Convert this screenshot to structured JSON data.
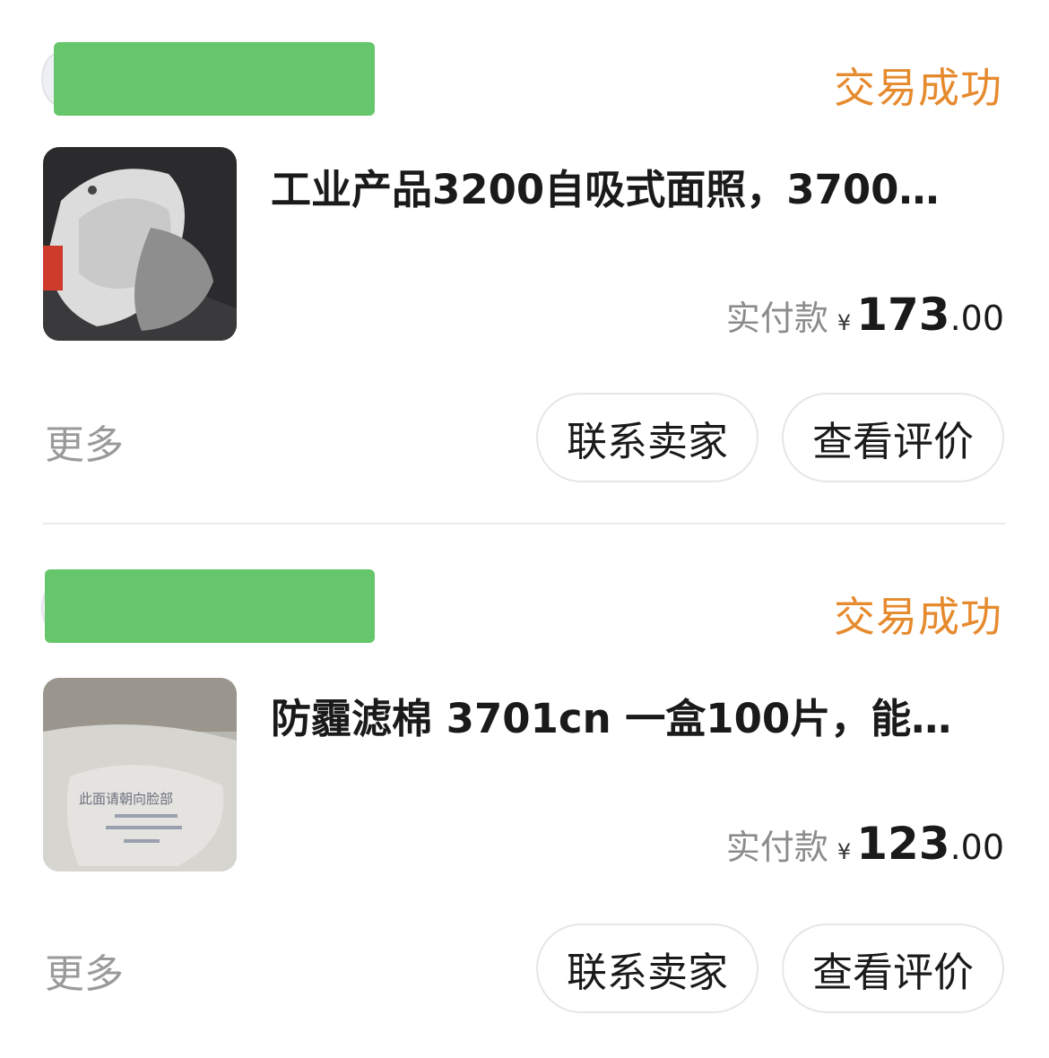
{
  "orders": [
    {
      "status": "交易成功",
      "title": "工业产品3200自吸式面照，3700…",
      "price_label": "实付款",
      "currency": "¥",
      "price_int": "173",
      "price_dec": ".00",
      "more": "更多",
      "contact_button": "联系卖家",
      "review_button": "查看评价"
    },
    {
      "status": "交易成功",
      "title": "防霾滤棉 3701cn 一盒100片，能…",
      "price_label": "实付款",
      "currency": "¥",
      "price_int": "123",
      "price_dec": ".00",
      "more": "更多",
      "contact_button": "联系卖家",
      "review_button": "查看评价",
      "thumb_text": "此面请朝向脸部"
    }
  ],
  "colors": {
    "status": "#e68a2e",
    "redaction": "#66c66b",
    "muted": "#9a9a9a"
  }
}
